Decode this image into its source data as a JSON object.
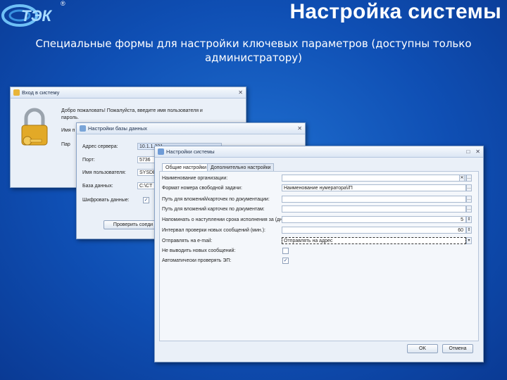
{
  "slide": {
    "title": "Настройка системы",
    "subtitle_line1": "Специальные  формы для настройки ключевых параметров (доступны только",
    "subtitle_line2": "администратору)",
    "logo_text": "СТЭК",
    "logo_mark": "®"
  },
  "login_window": {
    "title": "Вход в систему",
    "welcome_line1": "Добро пожаловать! Пожалуйста, введите имя пользователя и",
    "welcome_line2": "пароль.",
    "user_label": "Имя п",
    "password_label": "Пар"
  },
  "db_window": {
    "title": "Настройки базы данных",
    "server_label": "Адрес сервера:",
    "server_value": "10.1.1.231",
    "port_label": "Порт:",
    "port_value": "5736",
    "user_label": "Имя пользователя:",
    "user_value": "SYSDB",
    "db_label": "База данных:",
    "db_value": "C:\\CT",
    "encrypt_label": "Шифровать данные:",
    "encrypt_checked": true,
    "test_button": "Проверить соеди"
  },
  "settings_window": {
    "title": "Настройки системы",
    "tabs": [
      "Общие настройки",
      "Дополнительно настройки"
    ],
    "rows": [
      {
        "label": "Наименование организации:",
        "value": ""
      },
      {
        "label": "Формат номера свободной задачи:",
        "value": "Наименование нумератора\\/П"
      },
      {
        "label": "Путь для вложений/карточек по документации:",
        "value": ""
      },
      {
        "label": "Путь для вложений карточек по документам:",
        "value": ""
      },
      {
        "label": "Напоминать о наступлении срока исполнения за (дн.):",
        "value": "5"
      },
      {
        "label": "Интервал проверки новых сообщений (мин.):",
        "value": "60"
      },
      {
        "label": "Отправлять на e-mail:",
        "value": "Отправлять на адрес"
      },
      {
        "label": "Не выводить новых сообщений:",
        "checked": false
      },
      {
        "label": "Автоматически проверять ЭП:",
        "checked": true
      }
    ],
    "ok_button": "OK",
    "cancel_button": "Отмена"
  },
  "colors": {
    "background": "#0f4fb4",
    "logo": "#4aa8ef",
    "window_bg": "#eaf0f8"
  }
}
